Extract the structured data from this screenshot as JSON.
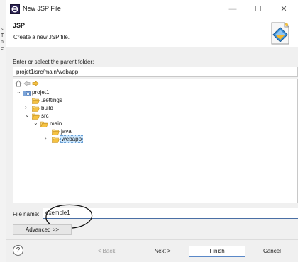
{
  "background_window": {
    "fragments": [
      "si",
      "T",
      "n",
      "e"
    ]
  },
  "window": {
    "title": "New JSP File",
    "controls": {
      "minimize": "—",
      "maximize": "☐",
      "close": "✕"
    }
  },
  "header": {
    "title": "JSP",
    "description": "Create a new JSP file."
  },
  "parent_folder": {
    "label": "Enter or select the parent folder:",
    "value": "projet1/src/main/webapp"
  },
  "tree": {
    "toolbar_icons": [
      "home-icon",
      "back-arrow-icon",
      "forward-arrow-icon"
    ],
    "items": [
      {
        "label": "projet1",
        "level": 0,
        "twisty": "expanded",
        "icon": "project-icon",
        "selected": false
      },
      {
        "label": ".settings",
        "level": 1,
        "twisty": "none",
        "icon": "folder-open-icon",
        "selected": false
      },
      {
        "label": "build",
        "level": 1,
        "twisty": "collapsed",
        "icon": "folder-open-icon",
        "selected": false
      },
      {
        "label": "src",
        "level": 1,
        "twisty": "expanded",
        "icon": "folder-open-icon",
        "selected": false
      },
      {
        "label": "main",
        "level": 2,
        "twisty": "expanded",
        "icon": "folder-open-icon",
        "selected": false
      },
      {
        "label": "java",
        "level": 3,
        "twisty": "none",
        "icon": "folder-open-icon",
        "selected": false
      },
      {
        "label": "webapp",
        "level": 3,
        "twisty": "collapsed",
        "icon": "folder-open-icon",
        "selected": true
      }
    ]
  },
  "file_name": {
    "label": "File name:",
    "value": "exemple1"
  },
  "advanced_button": "Advanced >>",
  "buttons": {
    "help": "?",
    "back": "< Back",
    "next": "Next >",
    "finish": "Finish",
    "cancel": "Cancel"
  },
  "colors": {
    "dialog_bg": "#f0f0f0",
    "selection": "#cce8ff",
    "folder": "#f5c242",
    "focus_border": "#5a88c8"
  }
}
